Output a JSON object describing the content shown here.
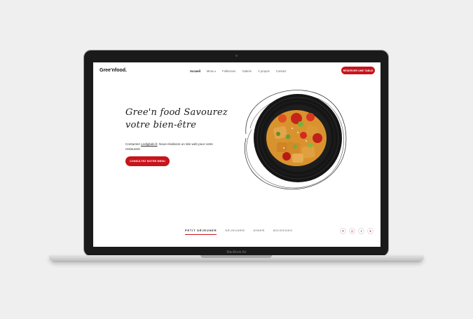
{
  "device_label": "MacBook Air",
  "site": {
    "logo": "Gree'nfood.",
    "nav": {
      "home": "Accueil",
      "menu": "Menu",
      "fullscreen": "Fullscreen",
      "gallery": "Galerie",
      "about": "À propos",
      "contact": "Contact"
    },
    "reserve_label": "RÉSERVER UNE TABLE",
    "hero": {
      "title_line1": "Gree'n food Savourez",
      "title_line2": "votre bien-être",
      "desc_prefix": "Contactez ",
      "desc_link": "Ledigitale.fr",
      "desc_suffix": ", Nous réalisons un site web pour votre restaurant.",
      "cta_label": "CONSULTEZ NOTRE MENU"
    },
    "tabs": [
      "PETIT DÉJEUNER",
      "DÉJEUNER",
      "DÎNER",
      "BOISSONS"
    ],
    "social_icons": [
      "whatsapp-icon",
      "instagram-icon",
      "facebook-icon",
      "twitter-icon"
    ],
    "colors": {
      "accent": "#c8141c",
      "background": "#ffffff"
    }
  }
}
